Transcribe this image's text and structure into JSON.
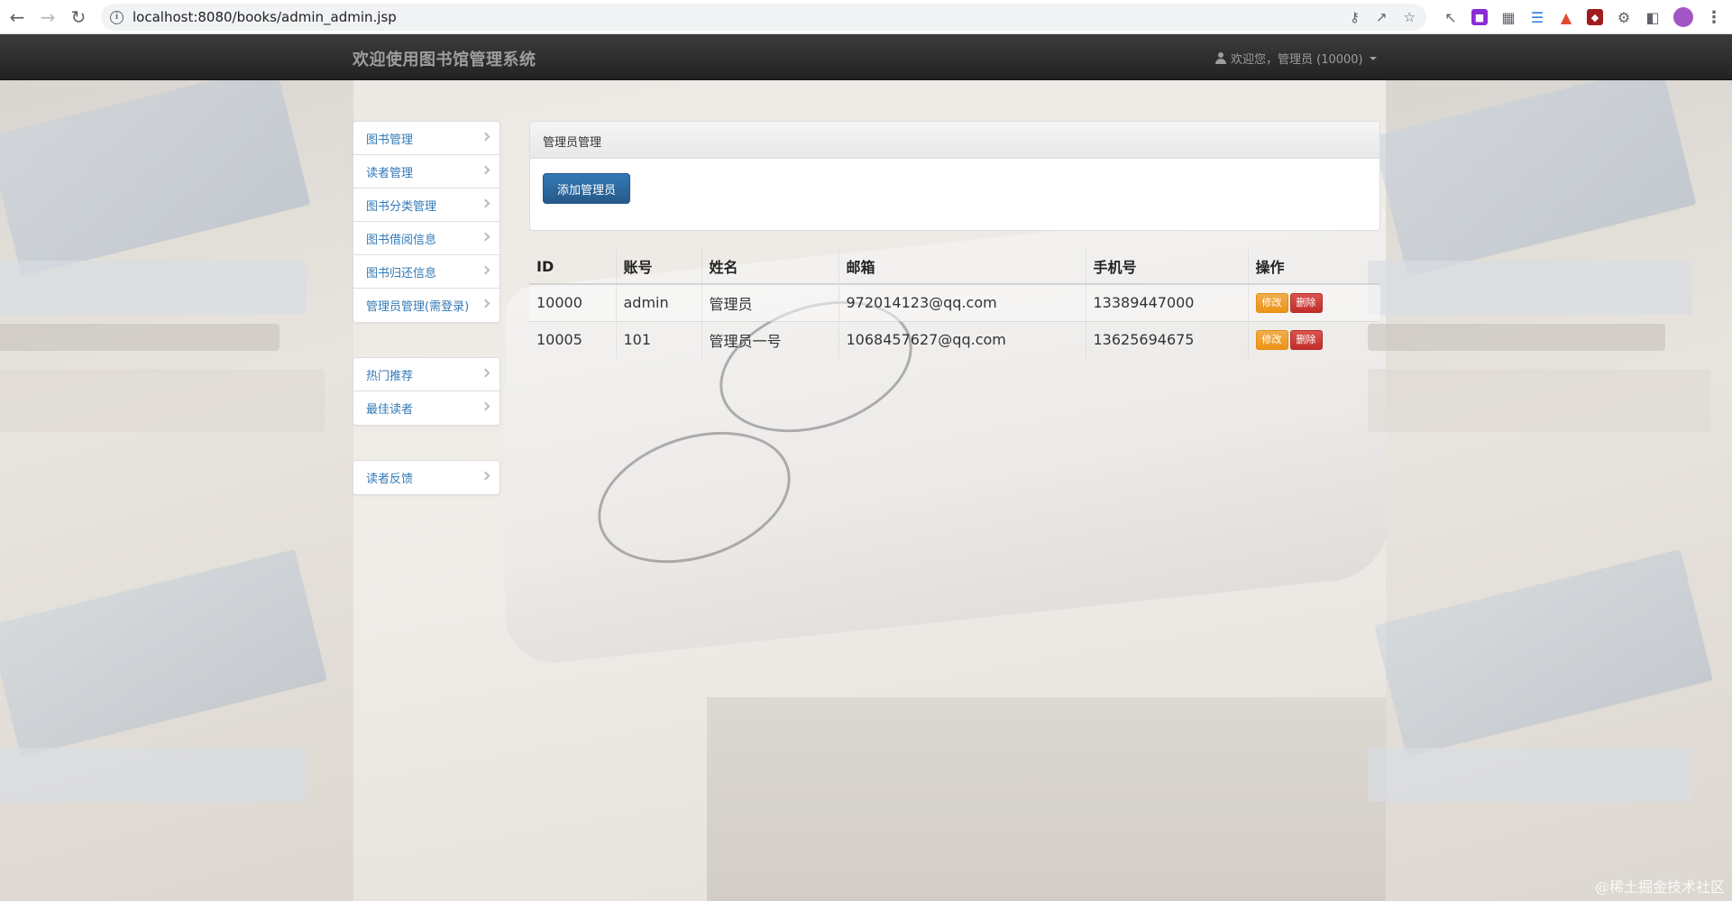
{
  "browser": {
    "url": "localhost:8080/books/admin_admin.jsp"
  },
  "navbar": {
    "brand": "欢迎使用图书馆管理系统",
    "user_label": "欢迎您，管理员 (10000)"
  },
  "sidebar": {
    "group1": [
      {
        "label": "图书管理"
      },
      {
        "label": "读者管理"
      },
      {
        "label": "图书分类管理"
      },
      {
        "label": "图书借阅信息"
      },
      {
        "label": "图书归还信息"
      },
      {
        "label": "管理员管理(需登录)"
      }
    ],
    "group2": [
      {
        "label": "热门推荐"
      },
      {
        "label": "最佳读者"
      }
    ],
    "group3": [
      {
        "label": "读者反馈"
      }
    ]
  },
  "panel": {
    "title": "管理员管理",
    "add_button": "添加管理员"
  },
  "table": {
    "headers": [
      "ID",
      "账号",
      "姓名",
      "邮箱",
      "手机号",
      "操作"
    ],
    "rows": [
      {
        "id": "10000",
        "account": "admin",
        "name": "管理员",
        "email": "972014123@qq.com",
        "phone": "13389447000",
        "edit": "修改",
        "delete": "删除"
      },
      {
        "id": "10005",
        "account": "101",
        "name": "管理员一号",
        "email": "1068457627@qq.com",
        "phone": "13625694675",
        "edit": "修改",
        "delete": "删除"
      }
    ]
  },
  "watermark": "@稀土掘金技术社区",
  "colors": {
    "navbar_bg": "#222222",
    "link": "#337ab7",
    "primary": "#337ab7",
    "warning": "#f0ad4e",
    "danger": "#d9534f"
  }
}
